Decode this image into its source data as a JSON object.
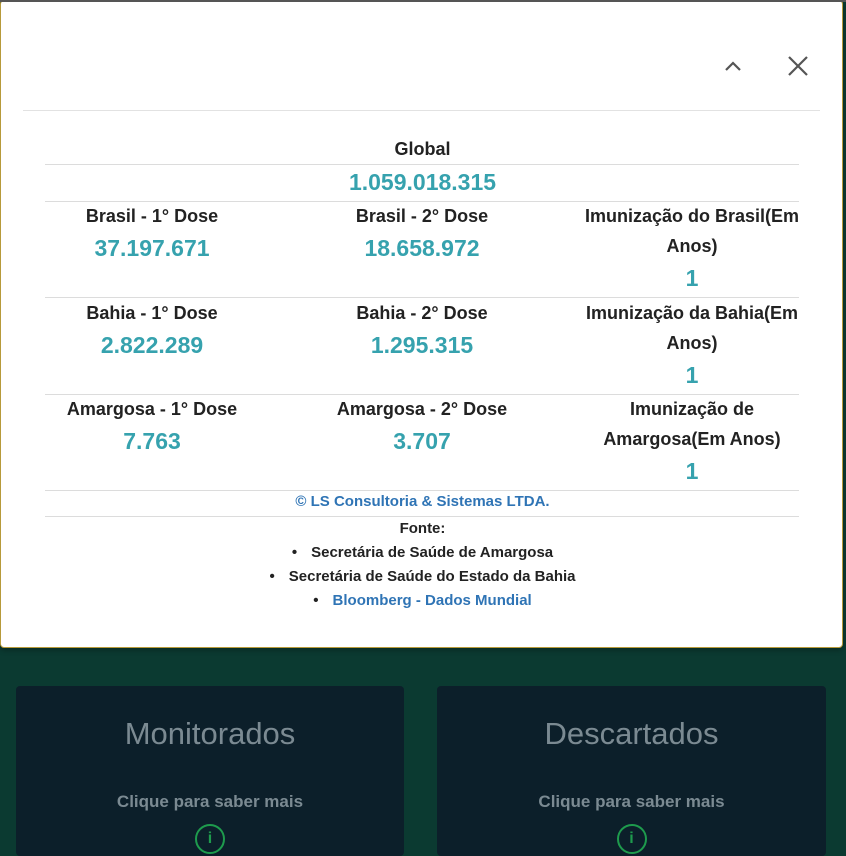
{
  "modal": {
    "global_label": "Global",
    "global_value": "1.059.018.315",
    "rows": [
      {
        "dose1_label": "Brasil - 1° Dose",
        "dose1_value": "37.197.671",
        "dose2_label": "Brasil - 2° Dose",
        "dose2_value": "18.658.972",
        "imun_label_line1": "Imunização do Brasil(Em",
        "imun_label_line2": "Anos)",
        "imun_value": "1"
      },
      {
        "dose1_label": "Bahia - 1° Dose",
        "dose1_value": "2.822.289",
        "dose2_label": "Bahia - 2° Dose",
        "dose2_value": "1.295.315",
        "imun_label_line1": "Imunização da Bahia(Em",
        "imun_label_line2": "Anos)",
        "imun_value": "1"
      },
      {
        "dose1_label": "Amargosa - 1° Dose",
        "dose1_value": "7.763",
        "dose2_label": "Amargosa - 2° Dose",
        "dose2_value": "3.707",
        "imun_label_line1": "Imunização de",
        "imun_label_line2": "Amargosa(Em Anos)",
        "imun_value": "1"
      }
    ],
    "copyright": "© LS Consultoria & Sistemas LTDA.",
    "fonte_title": "Fonte:",
    "sources": [
      "Secretária de Saúde de Amargosa",
      "Secretária de Saúde do Estado da Bahia",
      "Bloomberg - Dados Mundial"
    ],
    "bullet": "•",
    "collapse_icon": "chevron-up-icon",
    "close_icon": "close-icon"
  },
  "cards": {
    "left_title": "Monitorados",
    "left_sub": "Clique para saber mais",
    "right_title": "Descartados",
    "right_sub": "Clique para saber mais",
    "info_icon_glyph": "i"
  },
  "colors": {
    "value_teal": "#36a2ae",
    "link_blue": "#2f74b5",
    "background": "#0b3a31",
    "card_bg": "#0c1f2a"
  }
}
